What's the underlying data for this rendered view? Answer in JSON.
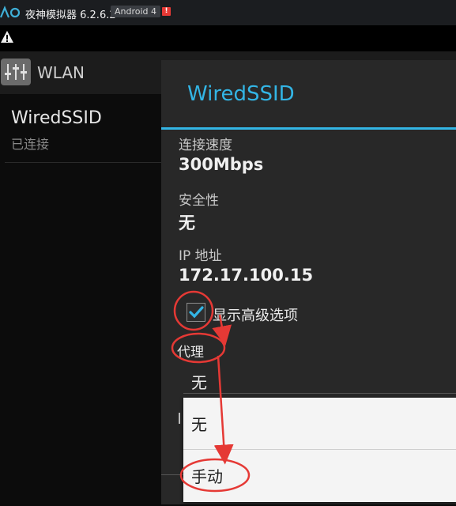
{
  "titlebar": {
    "app_name": "夜神模拟器 6.2.6.2",
    "android_badge": "Android 4",
    "alert_badge": "!"
  },
  "actionbar": {
    "title": "WLAN"
  },
  "network": {
    "ssid": "WiredSSID",
    "status": "已连接"
  },
  "dialog": {
    "title": "WiredSSID",
    "fields": [
      {
        "label": "连接速度",
        "value": "300Mbps"
      },
      {
        "label": "安全性",
        "value": "无"
      },
      {
        "label": "IP 地址",
        "value": "172.17.100.15"
      }
    ],
    "advanced_label": "显示高级选项",
    "advanced_checked": true,
    "proxy_label": "代理",
    "proxy_value": "无"
  },
  "dropdown": {
    "options": [
      "无",
      "手动"
    ]
  },
  "colors": {
    "accent": "#33b5e5",
    "annotation": "#e53935",
    "dialog_bg": "#282828"
  }
}
